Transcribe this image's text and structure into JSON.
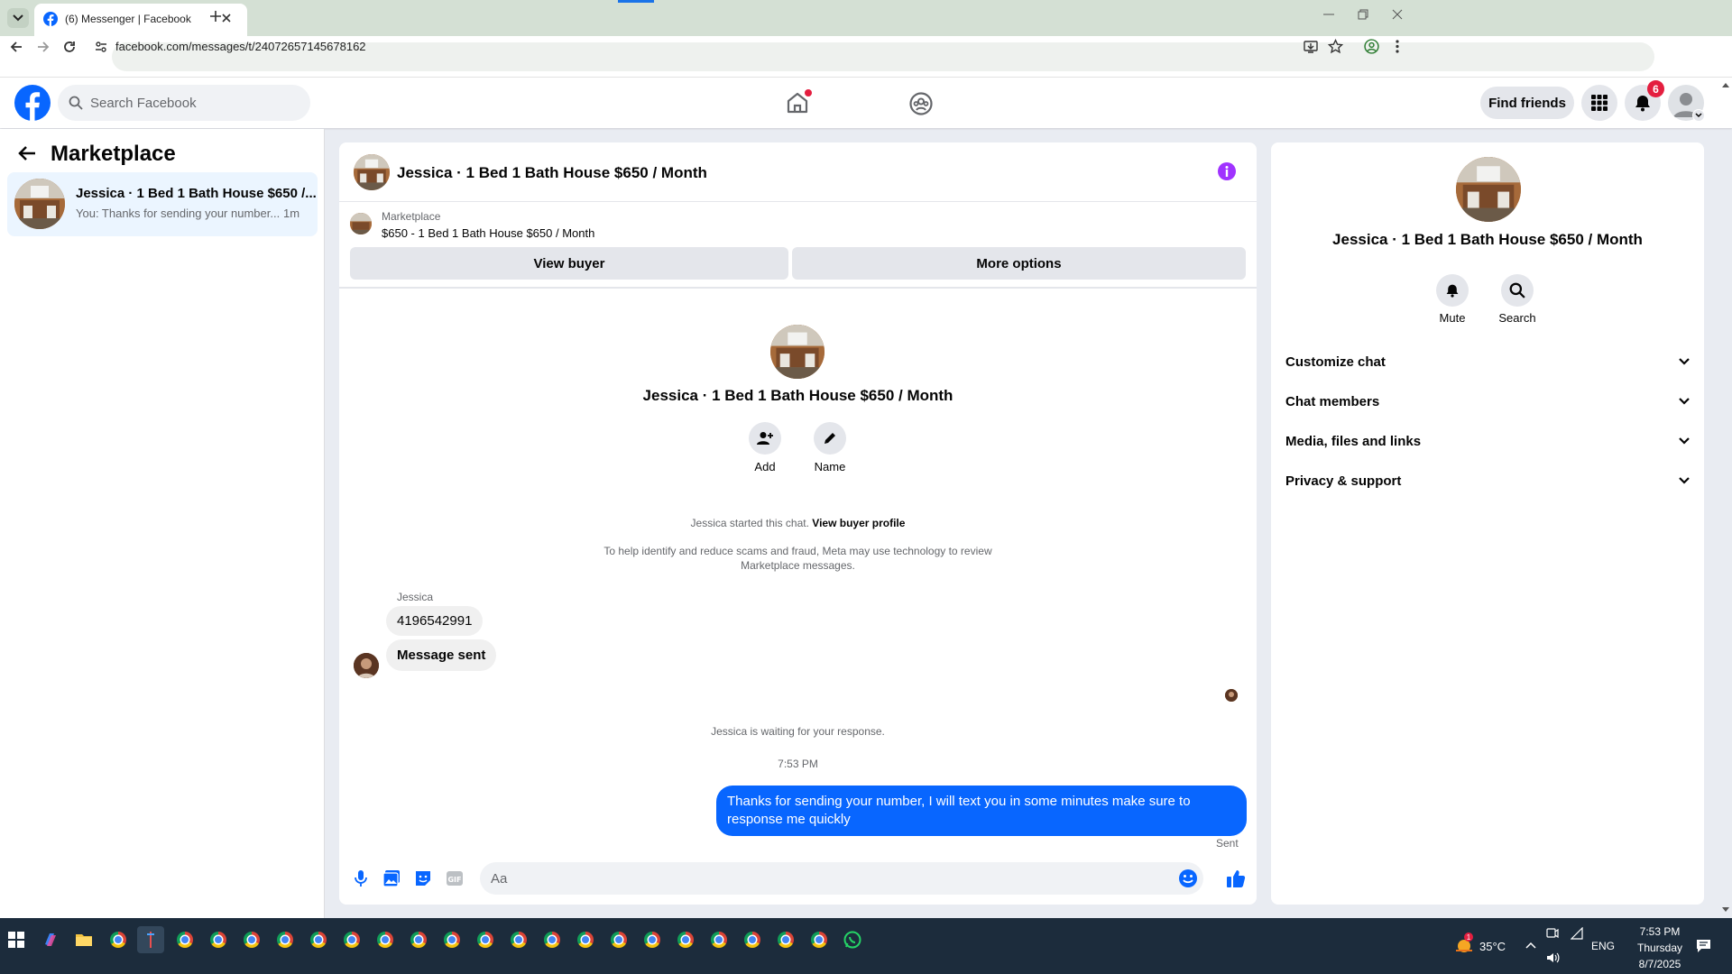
{
  "browser": {
    "tab_title": "(6) Messenger | Facebook",
    "url": "facebook.com/messages/t/24072657145678162"
  },
  "header": {
    "search_placeholder": "Search Facebook",
    "find_friends": "Find friends",
    "notification_count": "6"
  },
  "sidebar": {
    "title": "Marketplace",
    "conversation": {
      "name": "Jessica · 1 Bed 1 Bath House $650 /...",
      "preview": "You: Thanks for sending your number...",
      "time": "1m"
    }
  },
  "chat": {
    "title": "Jessica · 1 Bed 1 Bath House $650 / Month",
    "listing_source": "Marketplace",
    "listing_text": "$650 - 1 Bed 1 Bath House $650 / Month",
    "view_buyer": "View buyer",
    "more_options": "More options",
    "intro_title": "Jessica · 1 Bed 1 Bath House $650 / Month",
    "add_label": "Add",
    "name_label": "Name",
    "started_text": "Jessica started this chat.",
    "view_buyer_profile": "View buyer profile",
    "notice_line1": "To help identify and reduce scams and fraud, Meta may use technology to review",
    "notice_line2": "Marketplace messages.",
    "sender_name": "Jessica",
    "incoming": [
      "4196542991",
      "Message sent"
    ],
    "waiting_text": "Jessica is waiting for your response.",
    "timestamp": "7:53 PM",
    "outgoing_line1": "Thanks for sending your number, I will text you in some minutes make sure to",
    "outgoing_line2": "response me quickly",
    "sent_status": "Sent",
    "composer_placeholder": "Aa"
  },
  "info": {
    "title": "Jessica · 1 Bed 1 Bath House $650 / Month",
    "mute_label": "Mute",
    "search_label": "Search",
    "sections": [
      "Customize chat",
      "Chat members",
      "Media, files and links",
      "Privacy & support"
    ]
  },
  "taskbar": {
    "temperature": "35°C",
    "language": "ENG",
    "time": "7:53 PM",
    "day": "Thursday",
    "date": "8/7/2025",
    "weather_badge": "1"
  },
  "colors": {
    "accent": "#0866ff",
    "messenger_purple": "#a033ff",
    "notification_red": "#e41e3f"
  }
}
